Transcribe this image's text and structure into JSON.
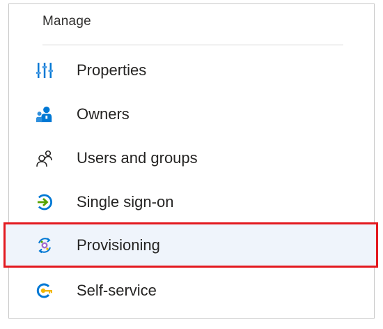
{
  "manage": {
    "header": "Manage",
    "items": [
      {
        "label": "Properties",
        "icon": "properties-icon",
        "selected": false
      },
      {
        "label": "Owners",
        "icon": "owners-icon",
        "selected": false
      },
      {
        "label": "Users and groups",
        "icon": "users-and-groups-icon",
        "selected": false
      },
      {
        "label": "Single sign-on",
        "icon": "single-sign-on-icon",
        "selected": false
      },
      {
        "label": "Provisioning",
        "icon": "provisioning-icon",
        "selected": true
      },
      {
        "label": "Self-service",
        "icon": "self-service-icon",
        "selected": false
      }
    ]
  },
  "colors": {
    "highlight_border": "#e3191f",
    "highlight_background": "#eff4fb",
    "accent_blue": "#0078d4",
    "accent_green": "#57a300",
    "accent_yellow": "#f2b600"
  }
}
